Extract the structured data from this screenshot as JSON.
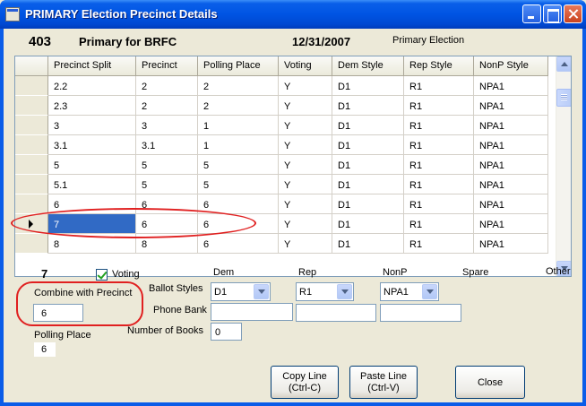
{
  "window": {
    "title": "PRIMARY Election Precinct Details"
  },
  "header": {
    "number": "403",
    "name": "Primary for BRFC",
    "date": "12/31/2007",
    "type": "Primary Election"
  },
  "grid": {
    "columns": [
      "Precinct Split",
      "Precinct",
      "Polling Place",
      "Voting",
      "Dem Style",
      "Rep Style",
      "NonP Style"
    ],
    "rows": [
      [
        "2.2",
        "2",
        "2",
        "Y",
        "D1",
        "R1",
        "NPA1"
      ],
      [
        "2.3",
        "2",
        "2",
        "Y",
        "D1",
        "R1",
        "NPA1"
      ],
      [
        "3",
        "3",
        "1",
        "Y",
        "D1",
        "R1",
        "NPA1"
      ],
      [
        "3.1",
        "3.1",
        "1",
        "Y",
        "D1",
        "R1",
        "NPA1"
      ],
      [
        "5",
        "5",
        "5",
        "Y",
        "D1",
        "R1",
        "NPA1"
      ],
      [
        "5.1",
        "5",
        "5",
        "Y",
        "D1",
        "R1",
        "NPA1"
      ],
      [
        "6",
        "6",
        "6",
        "Y",
        "D1",
        "R1",
        "NPA1"
      ],
      [
        "7",
        "6",
        "6",
        "Y",
        "D1",
        "R1",
        "NPA1"
      ],
      [
        "8",
        "8",
        "6",
        "Y",
        "D1",
        "R1",
        "NPA1"
      ]
    ],
    "selected_row_index": 7
  },
  "detail": {
    "precinct": "7",
    "voting_label": "Voting",
    "voting_checked": true,
    "combine_label": "Combine with Precinct",
    "combine_value": "6",
    "polling_label": "Polling Place",
    "polling_value": "6",
    "ballot_styles_label": "Ballot Styles",
    "phone_bank_label": "Phone Bank",
    "num_books_label": "Number of Books",
    "num_books_value": "0",
    "columns": {
      "dem": "Dem",
      "rep": "Rep",
      "nonp": "NonP",
      "spare": "Spare",
      "other": "Other"
    },
    "dem_style": "D1",
    "rep_style": "R1",
    "nonp_style": "NPA1"
  },
  "buttons": {
    "copy_line": [
      "Copy Line",
      "(Ctrl-C)"
    ],
    "paste_line": [
      "Paste Line",
      "(Ctrl-V)"
    ],
    "close": "Close"
  },
  "colors": {
    "selection": "#316ac5",
    "annotation_red": "#e02020",
    "titlebar_blue": "#0054e3"
  }
}
